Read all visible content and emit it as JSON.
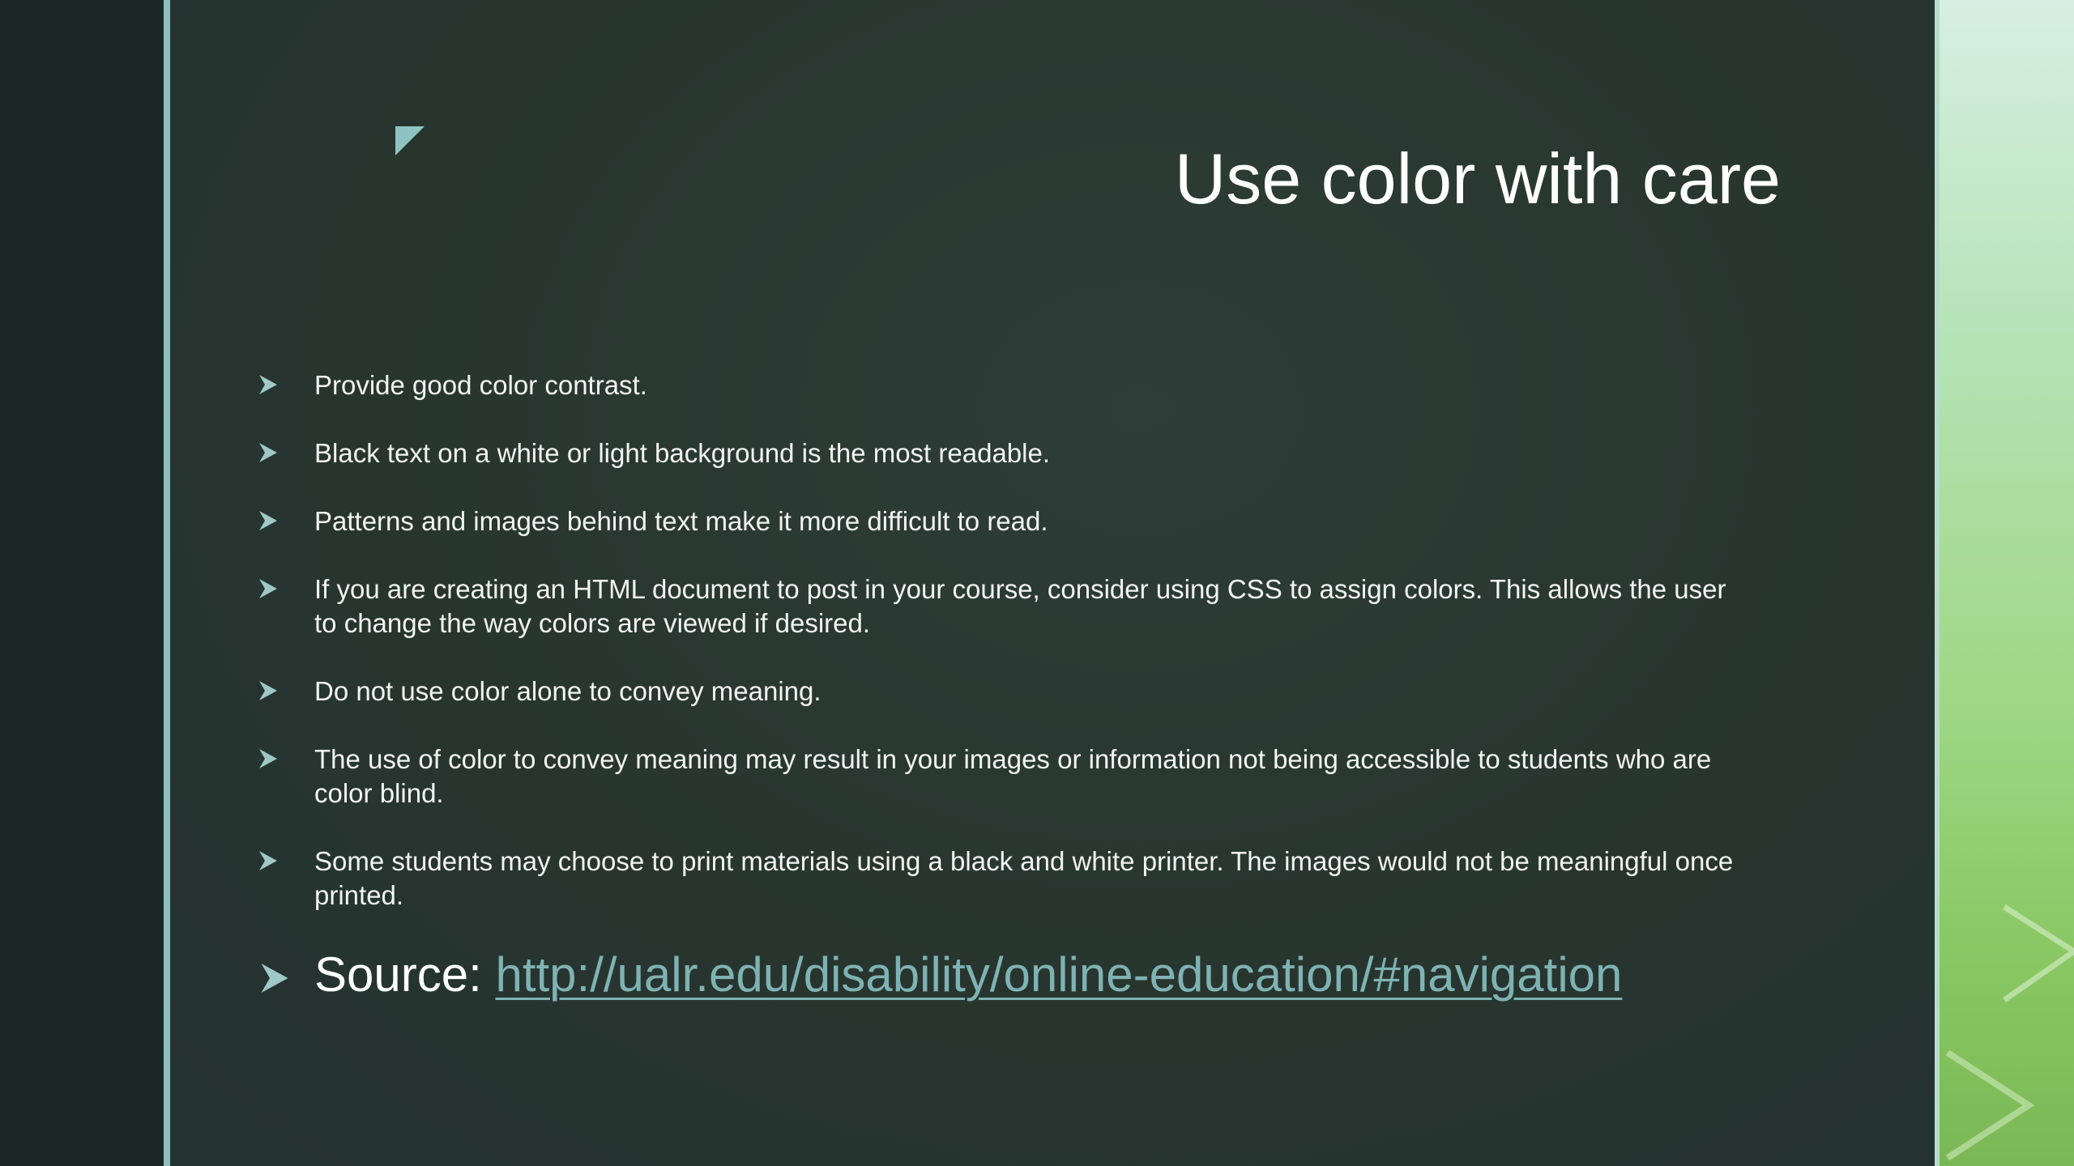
{
  "slide": {
    "title": "Use color with care",
    "bullets": [
      "Provide good color contrast.",
      "Black text on a white or light background is the most readable.",
      "Patterns and images behind text make it more difficult to read.",
      "If you are creating an HTML document to post in your course, consider using CSS to assign colors. This allows the user to change the way colors are viewed if desired.",
      "Do not use color alone to convey meaning.",
      "The use of color to convey meaning may result in your images or information not being accessible to students who are color blind.",
      "Some students may choose to print materials using a black and white printer. The images would not be meaningful once printed."
    ],
    "source_label": "Source:",
    "source_link": "http://ualr.edu/disability/online-education/#navigation",
    "icons": {
      "bullet": "arrowhead-bullet-icon",
      "corner": "corner-triangle-icon",
      "decoration": "chevron-decoration-icon"
    },
    "colors": {
      "background": "#28352f",
      "accent": "#8fbfbd",
      "link": "#7fb2b3",
      "text": "#ffffff",
      "side_green": "#9fd785"
    }
  }
}
